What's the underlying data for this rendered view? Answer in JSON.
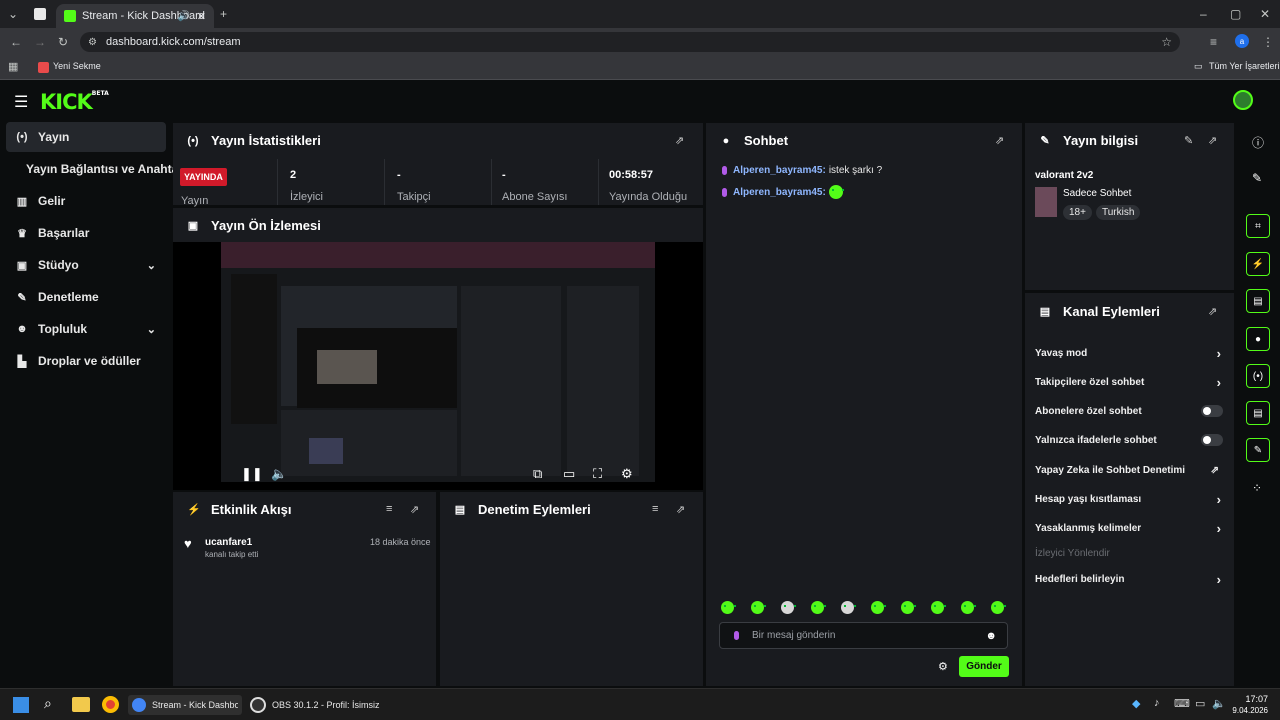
{
  "browser": {
    "tab_title": "Stream - Kick Dashboard",
    "url": "dashboard.kick.com/stream",
    "bookmark_new_tab": "Yeni Sekme",
    "bookmark_all": "Tüm Yer İşaretleri",
    "profile_initial": "a"
  },
  "app": {
    "logo": "KICK",
    "logo_badge": "BETA"
  },
  "sidebar": {
    "items": [
      {
        "label": "Yayın",
        "icon": "broadcast-icon"
      },
      {
        "label": "Yayın Bağlantısı ve Anahtarı",
        "icon": ""
      },
      {
        "label": "Gelir",
        "icon": "chart-icon"
      },
      {
        "label": "Başarılar",
        "icon": "trophy-icon"
      },
      {
        "label": "Stüdyo",
        "icon": "studio-icon"
      },
      {
        "label": "Denetleme",
        "icon": "wrench-icon"
      },
      {
        "label": "Topluluk",
        "icon": "people-icon"
      },
      {
        "label": "Droplar ve ödüller",
        "icon": "gift-icon"
      }
    ]
  },
  "stats": {
    "title": "Yayın İstatistikleri",
    "live_badge": "YAYINDA",
    "live_label": "Yayın",
    "cells": [
      {
        "value": "2",
        "label": "İzleyici"
      },
      {
        "value": "-",
        "label": "Takipçi"
      },
      {
        "value": "-",
        "label": "Abone Sayısı"
      },
      {
        "value": "00:58:57",
        "label": "Yayında Olduğu"
      }
    ]
  },
  "preview": {
    "title": "Yayın Ön İzlemesi"
  },
  "activity": {
    "title": "Etkinlik Akışı",
    "items": [
      {
        "user": "ucanfare1",
        "text": "kanalı takip etti",
        "time": "18 dakika önce"
      }
    ]
  },
  "moderation": {
    "title": "Denetim Eylemleri"
  },
  "chat": {
    "title": "Sohbet",
    "messages": [
      {
        "user": "Alperen_bayram45:",
        "text": "istek şarkı ?"
      },
      {
        "user": "Alperen_bayram45:",
        "text": ""
      }
    ],
    "input_placeholder": "Bir mesaj gönderin",
    "send_label": "Gönder"
  },
  "stream_info": {
    "title": "Yayın bilgisi",
    "stream_title": "valorant 2v2",
    "category": "Sadece Sohbet",
    "tags": [
      "18+",
      "Turkish"
    ]
  },
  "channel_actions": {
    "title": "Kanal Eylemleri",
    "items": [
      {
        "label": "Yavaş mod",
        "control": "chevron"
      },
      {
        "label": "Takipçilere özel sohbet",
        "control": "chevron"
      },
      {
        "label": "Abonelere özel sohbet",
        "control": "toggle"
      },
      {
        "label": "Yalnızca ifadelerle sohbet",
        "control": "toggle"
      },
      {
        "label": "Yapay Zeka ile Sohbet Denetimi",
        "control": "external"
      },
      {
        "label": "Hesap yaşı kısıtlaması",
        "control": "chevron"
      },
      {
        "label": "Yasaklanmış kelimeler",
        "control": "chevron"
      },
      {
        "label": "İzleyici Yönlendir",
        "control": "disabled"
      },
      {
        "label": "Hedefleri belirleyin",
        "control": "chevron"
      }
    ]
  },
  "taskbar": {
    "chrome_item": "Stream - Kick Dashboard",
    "obs_item": "OBS 30.1.2 - Profil: İsimsiz",
    "time": "17:07",
    "date": "9.04.2026"
  },
  "colors": {
    "accent": "#53fc18",
    "live": "#d11a2a",
    "panel": "#191b1f",
    "background": "#0b0d0e"
  }
}
